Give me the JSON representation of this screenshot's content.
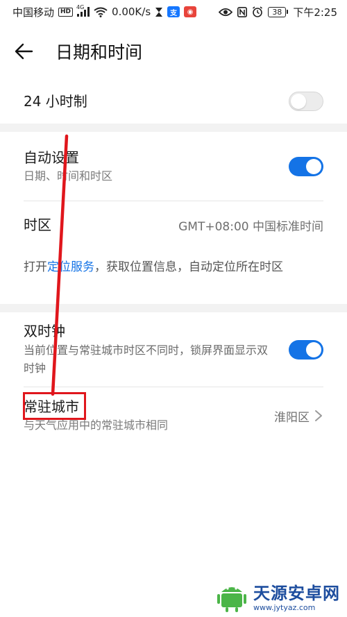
{
  "status_bar": {
    "carrier": "中国移动",
    "hd": "HD",
    "network": "4G",
    "speed": "0.00K/s",
    "battery": "38",
    "time": "下午2:25",
    "icons": [
      "hd-icon",
      "signal-icon",
      "wifi-icon",
      "hourglass-icon",
      "alipay-icon",
      "app-icon",
      "eye-icon",
      "nfc-icon",
      "alarm-icon",
      "battery-icon"
    ]
  },
  "header": {
    "title": "日期和时间"
  },
  "settings": {
    "hour24": {
      "label": "24 小时制",
      "enabled": false
    },
    "auto_set": {
      "label": "自动设置",
      "description": "日期、时间和时区",
      "enabled": true
    },
    "timezone": {
      "label": "时区",
      "value": "GMT+08:00 中国标准时间"
    },
    "location_info": {
      "prefix": "打开",
      "link": "定位服务",
      "suffix": "，获取位置信息，自动定位所在时区"
    },
    "dual_clock": {
      "label": "双时钟",
      "description": "当前位置与常驻城市时区不同时，锁屏界面显示双时钟",
      "enabled": true
    },
    "home_city": {
      "label": "常驻城市",
      "description": "与天气应用中的常驻城市相同",
      "value": "淮阳区"
    }
  },
  "watermark": {
    "name": "天源安卓网",
    "url": "www.jytyaz.com"
  },
  "colors": {
    "accent": "#1473e6",
    "annotation": "#e0161c",
    "watermark": "#1d4d9e"
  }
}
